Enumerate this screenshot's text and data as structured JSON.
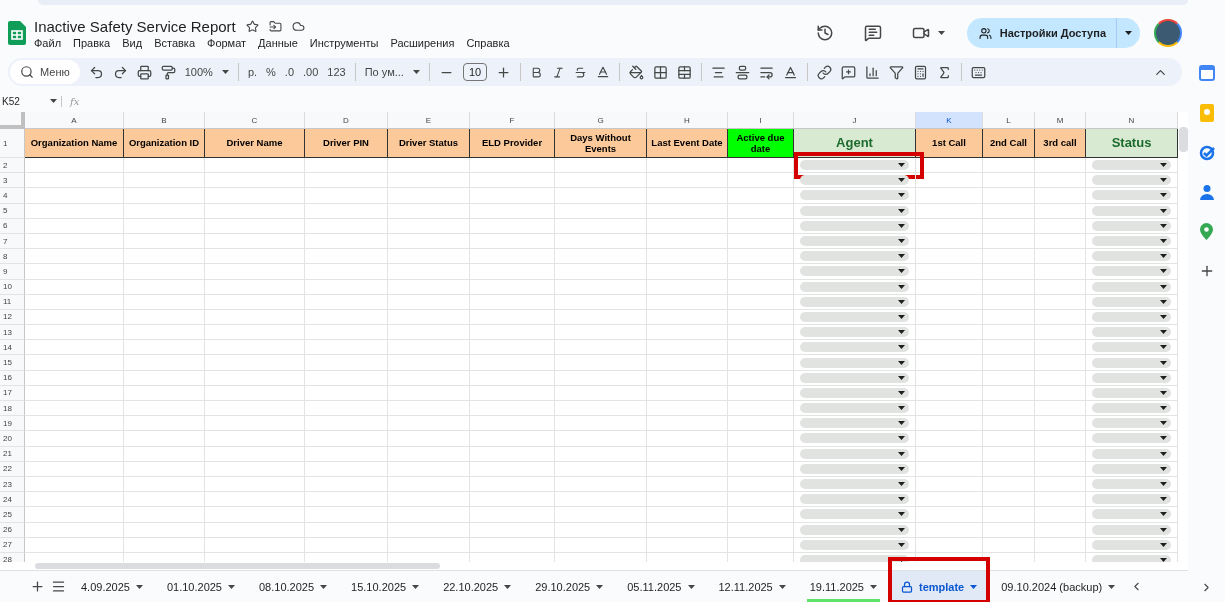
{
  "document": {
    "title": "Inactive Safety Service Report"
  },
  "menu": [
    "Файл",
    "Правка",
    "Вид",
    "Вставка",
    "Формат",
    "Данные",
    "Инструменты",
    "Расширения",
    "Справка"
  ],
  "share_button": "Настройки Доступа",
  "toolbar": {
    "search": "Меню",
    "zoom": "100%",
    "currency": "р.",
    "percent": "%",
    "decrease_decimals": ".0",
    "increase_decimals": ".00",
    "number_format": "123",
    "font": "По ум...",
    "font_size": "10"
  },
  "formula_bar": {
    "cell_ref": "K52",
    "fx": "fx"
  },
  "columns": [
    {
      "letter": "A",
      "header": "Organization Name",
      "color": "#fcc99a",
      "kind": "text",
      "selected": false
    },
    {
      "letter": "B",
      "header": "Organization ID",
      "color": "#fcc99a",
      "kind": "text",
      "selected": false
    },
    {
      "letter": "C",
      "header": "Driver Name",
      "color": "#fcc99a",
      "kind": "text",
      "selected": false
    },
    {
      "letter": "D",
      "header": "Driver PIN",
      "color": "#fcc99a",
      "kind": "text",
      "selected": false
    },
    {
      "letter": "E",
      "header": "Driver Status",
      "color": "#fcc99a",
      "kind": "text",
      "selected": false
    },
    {
      "letter": "F",
      "header": "ELD Provider",
      "color": "#fcc99a",
      "kind": "text",
      "selected": false
    },
    {
      "letter": "G",
      "header": "Days Without Events",
      "color": "#fcc99a",
      "kind": "text",
      "selected": false
    },
    {
      "letter": "H",
      "header": "Last Event Date",
      "color": "#fcc99a",
      "kind": "text",
      "selected": false
    },
    {
      "letter": "I",
      "header": "Active due date",
      "color": "#00ff00",
      "kind": "text",
      "selected": false
    },
    {
      "letter": "J",
      "header": "Agent",
      "color": "#d9ead3",
      "kind": "dropdown",
      "selected": false
    },
    {
      "letter": "K",
      "header": "1st Call",
      "color": "#fcc99a",
      "kind": "text",
      "selected": true
    },
    {
      "letter": "L",
      "header": "2nd Call",
      "color": "#fcc99a",
      "kind": "text",
      "selected": false
    },
    {
      "letter": "M",
      "header": "3rd call",
      "color": "#fcc99a",
      "kind": "text",
      "selected": false
    },
    {
      "letter": "N",
      "header": "Status",
      "color": "#d9ead3",
      "kind": "dropdown",
      "selected": false
    }
  ],
  "rows": [
    {
      "number": "2",
      "highlighted": true
    },
    {
      "number": "3"
    },
    {
      "number": "4"
    },
    {
      "number": "5"
    },
    {
      "number": "6"
    },
    {
      "number": "7"
    },
    {
      "number": "8"
    },
    {
      "number": "9"
    },
    {
      "number": "10"
    },
    {
      "number": "11"
    },
    {
      "number": "12"
    },
    {
      "number": "13"
    },
    {
      "number": "14"
    },
    {
      "number": "15"
    },
    {
      "number": "16"
    },
    {
      "number": "17"
    },
    {
      "number": "18"
    },
    {
      "number": "19"
    },
    {
      "number": "20"
    },
    {
      "number": "21"
    },
    {
      "number": "22"
    },
    {
      "number": "23"
    },
    {
      "number": "24"
    },
    {
      "number": "25"
    },
    {
      "number": "26"
    },
    {
      "number": "27"
    },
    {
      "number": "28"
    }
  ],
  "header_row_number": "1",
  "sheet_tabs": [
    {
      "label": "4.09.2025",
      "selected": false,
      "locked": false,
      "highlighted": false
    },
    {
      "label": "01.10.2025",
      "selected": false,
      "locked": false,
      "highlighted": false
    },
    {
      "label": "08.10.2025",
      "selected": false,
      "locked": false,
      "highlighted": false
    },
    {
      "label": "15.10.2025",
      "selected": false,
      "locked": false,
      "highlighted": false
    },
    {
      "label": "22.10.2025",
      "selected": false,
      "locked": false,
      "highlighted": false
    },
    {
      "label": "29.10.2025",
      "selected": false,
      "locked": false,
      "highlighted": false
    },
    {
      "label": "05.11.2025",
      "selected": false,
      "locked": false,
      "highlighted": false
    },
    {
      "label": "12.11.2025",
      "selected": false,
      "locked": false,
      "highlighted": false
    },
    {
      "label": "19.11.2025",
      "selected": false,
      "locked": false,
      "highlighted": false,
      "color": "#5ee26a"
    },
    {
      "label": "template",
      "selected": true,
      "locked": true,
      "highlighted": true
    },
    {
      "label": "09.10.2024 (backup)",
      "selected": false,
      "locked": false,
      "highlighted": false
    }
  ]
}
